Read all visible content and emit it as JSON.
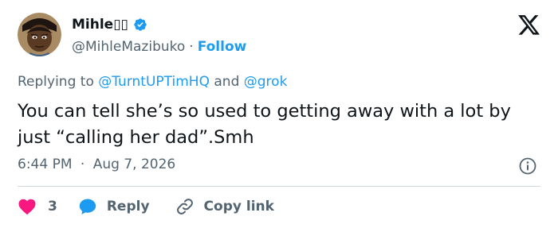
{
  "colors": {
    "accent": "#1d9bf0",
    "secondary_text": "#536471",
    "primary_text": "#0f1419",
    "like": "#f91880",
    "divider": "#cfd9de"
  },
  "author": {
    "display_name": "Mihle▯▯",
    "handle": "@MihleMazibuko",
    "separator": "·",
    "follow_label": "Follow"
  },
  "reply_context": {
    "prefix": "Replying to",
    "mention_1": "@TurntUPTimHQ",
    "conjunction": "and",
    "mention_2": "@grok"
  },
  "tweet": {
    "text": "You can tell she’s so used to getting away with a lot by just “calling her dad”.Smh",
    "time": "6:44 PM",
    "separator": "·",
    "date": "Aug 7, 2026"
  },
  "actions": {
    "like_count": "3",
    "reply_label": "Reply",
    "copy_link_label": "Copy link"
  },
  "icons": {
    "verified": "verified-badge-icon",
    "logo": "x-logo-icon",
    "info": "info-icon",
    "like": "heart-icon",
    "reply": "chat-bubble-icon",
    "copy": "link-icon"
  }
}
